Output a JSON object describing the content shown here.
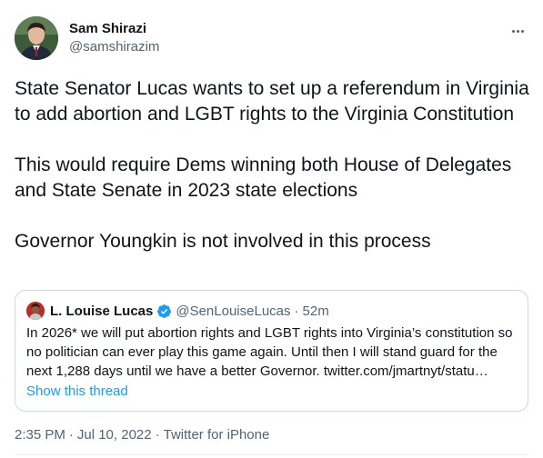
{
  "author": {
    "display_name": "Sam Shirazi",
    "handle": "@samshirazim",
    "avatar_icon": "profile-photo-icon"
  },
  "more_icon": "more-horizontal-icon",
  "tweet": {
    "paragraphs": [
      "State Senator Lucas wants to set up a referendum in Virginia to add abortion and LGBT rights to the Virginia Constitution",
      "This would require Dems winning both House of Delegates and State Senate in 2023 state elections",
      "Governor Youngkin is not involved in this process"
    ]
  },
  "quote": {
    "display_name": "L. Louise Lucas",
    "verified_icon": "verified-badge-icon",
    "handle": "@SenLouiseLucas",
    "separator": "·",
    "time": "52m",
    "text": "In 2026* we will put abortion rights and LGBT rights into Virginia’s constitution so no politician can ever play this game again.  Until then I will stand guard for the next 1,288 days until we have a better Governor. twitter.com/jmartnyt/statu…",
    "show_thread": "Show this thread"
  },
  "meta": {
    "time": "2:35 PM",
    "separator": "·",
    "date": "Jul 10, 2022",
    "source": "Twitter for iPhone"
  },
  "colors": {
    "text": "#0f1419",
    "secondary": "#536471",
    "link": "#1d9bf0",
    "border": "#cfd9de"
  }
}
